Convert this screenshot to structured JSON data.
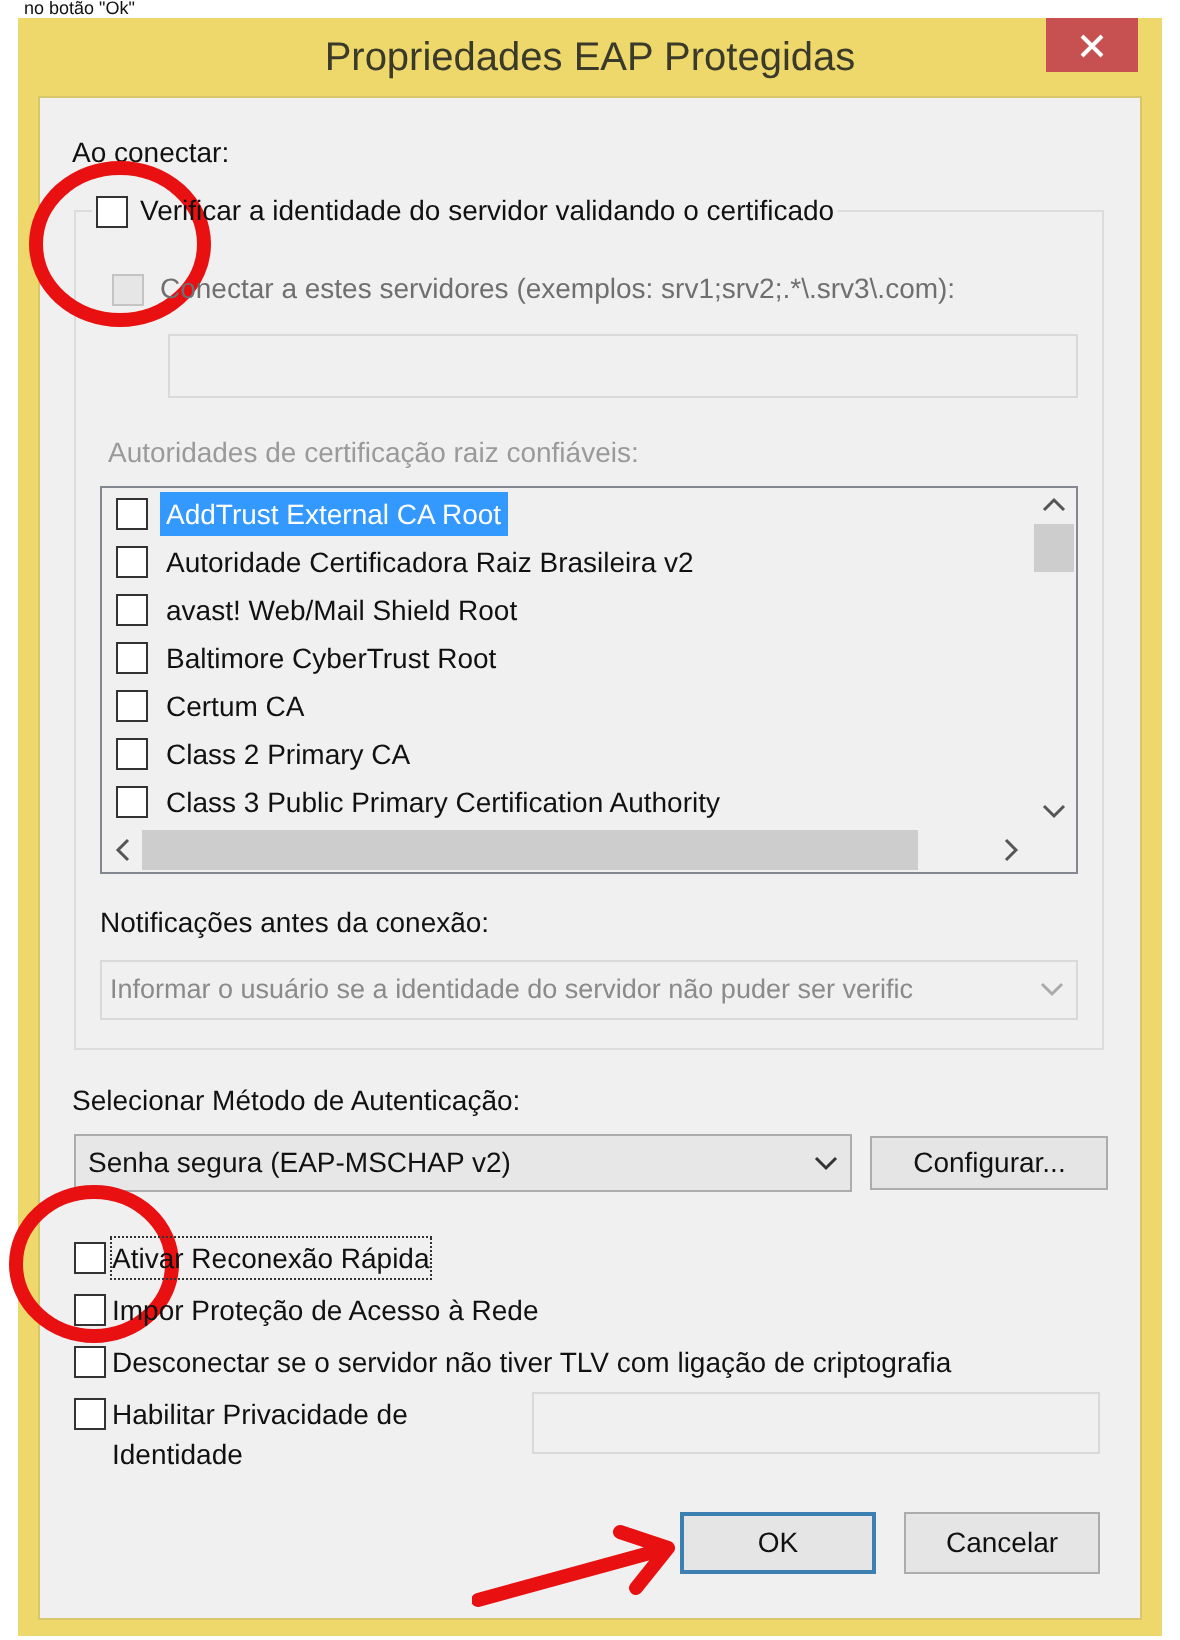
{
  "caption": "no botão \"Ok\"",
  "window": {
    "title": "Propriedades EAP Protegidas"
  },
  "connect_section": {
    "label": "Ao conectar:",
    "verify_server": {
      "label": "Verificar a identidade do servidor validando o certificado",
      "checked": false
    },
    "connect_servers": {
      "label": "Conectar a estes servidores (exemplos: srv1;srv2;.*\\.srv3\\.com):",
      "checked": false,
      "disabled": true
    },
    "servers_field": {
      "disabled": true
    },
    "cas_label": {
      "text": "Autoridades de certificação raiz confiáveis:",
      "disabled": true
    },
    "certificates": [
      {
        "name": "AddTrust External CA Root",
        "checked": false,
        "selected": true
      },
      {
        "name": "Autoridade Certificadora Raiz Brasileira v2",
        "checked": false,
        "selected": false
      },
      {
        "name": "avast! Web/Mail Shield Root",
        "checked": false,
        "selected": false
      },
      {
        "name": "Baltimore CyberTrust Root",
        "checked": false,
        "selected": false
      },
      {
        "name": "Certum CA",
        "checked": false,
        "selected": false
      },
      {
        "name": "Class 2 Primary CA",
        "checked": false,
        "selected": false
      },
      {
        "name": "Class 3 Public Primary Certification Authority",
        "checked": false,
        "selected": false
      }
    ],
    "notifications": {
      "label": "Notificações antes da conexão:",
      "value": "Informar o usuário se a identidade do servidor não puder ser verific",
      "disabled": true
    }
  },
  "auth_method": {
    "label": "Selecionar Método de Autenticação:",
    "value": "Senha segura (EAP-MSCHAP v2)",
    "configure_button": "Configurar..."
  },
  "options": [
    {
      "label": "Ativar Reconexão Rápida",
      "checked": false,
      "focused": true,
      "kind": "plain"
    },
    {
      "label": "Impor Proteção de Acesso à Rede",
      "checked": false,
      "focused": false,
      "kind": "plain"
    },
    {
      "label": "Desconectar se o servidor não tiver TLV com ligação de criptografia",
      "checked": false,
      "focused": false,
      "kind": "plain"
    },
    {
      "label": "Habilitar Privacidade de Identidade",
      "checked": false,
      "focused": false,
      "kind": "with_field"
    }
  ],
  "buttons": [
    {
      "label": "OK",
      "default": true
    },
    {
      "label": "Cancelar",
      "default": false
    }
  ]
}
